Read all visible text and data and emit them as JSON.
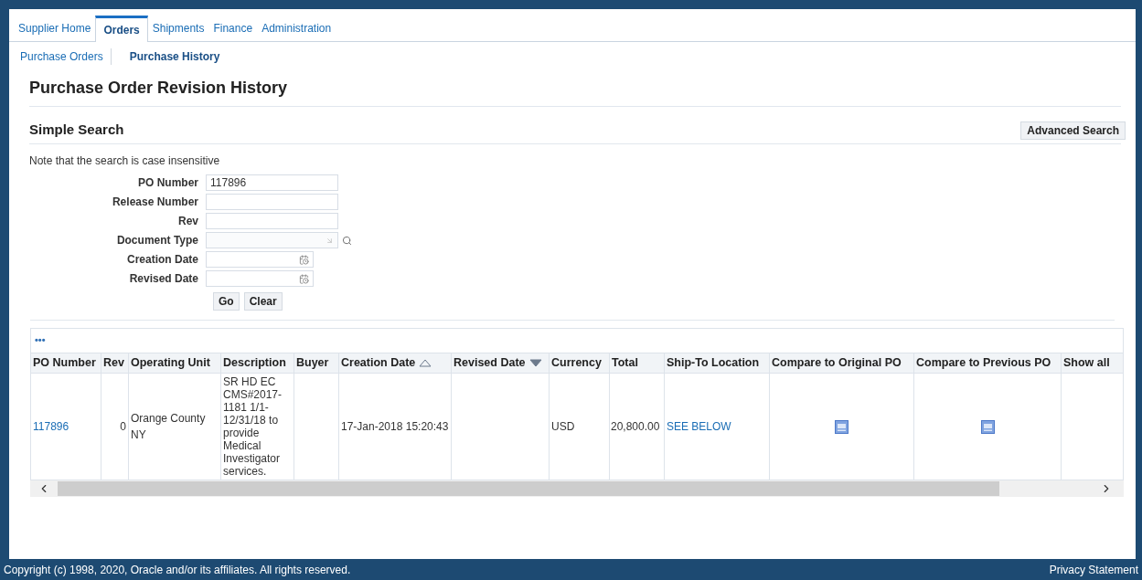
{
  "tabs": [
    {
      "label": "Supplier Home",
      "selected": false
    },
    {
      "label": "Orders",
      "selected": true
    },
    {
      "label": "Shipments",
      "selected": false
    },
    {
      "label": "Finance",
      "selected": false
    },
    {
      "label": "Administration",
      "selected": false
    }
  ],
  "subtabs": [
    {
      "label": "Purchase Orders",
      "selected": false
    },
    {
      "label": "Purchase History",
      "selected": true
    }
  ],
  "page_title": "Purchase Order Revision History",
  "search": {
    "title": "Simple Search",
    "advanced_button": "Advanced Search",
    "note": "Note that the search is case insensitive",
    "fields": [
      {
        "label": "PO Number",
        "kind": "text",
        "value": "117896"
      },
      {
        "label": "Release Number",
        "kind": "text"
      },
      {
        "label": "Rev",
        "kind": "text"
      },
      {
        "label": "Document Type",
        "kind": "lov"
      },
      {
        "label": "Creation Date",
        "kind": "date"
      },
      {
        "label": "Revised Date",
        "kind": "date"
      }
    ],
    "buttons": [
      "Go",
      "Clear"
    ]
  },
  "table": {
    "more": "•••",
    "columns": [
      {
        "label": "PO Number"
      },
      {
        "label": "Rev"
      },
      {
        "label": "Operating Unit"
      },
      {
        "label": "Description"
      },
      {
        "label": "Buyer"
      },
      {
        "label": "Creation Date",
        "kind": "ascending",
        "active": false
      },
      {
        "label": "Revised Date",
        "kind": "descending",
        "active": true
      },
      {
        "label": "Currency"
      },
      {
        "label": "Total"
      },
      {
        "label": "Ship-To Location"
      },
      {
        "label": "Compare to Original PO"
      },
      {
        "label": "Compare to Previous PO"
      },
      {
        "label": "Show all"
      }
    ],
    "rows": [
      {
        "po_number": "117896",
        "rev": "0",
        "operating_unit": "Orange County NY",
        "description": "SR HD EC CMS#2017-1181 1/1-12/31/18 to provide Medical Investigator services.",
        "creation_date": "17-Jan-2018 15:20:43",
        "currency": "USD",
        "total": "20,800.00",
        "ship_to": "SEE BELOW"
      }
    ]
  },
  "footer": {
    "copyright": "Copyright (c) 1998, 2020, Oracle and/or its affiliates. All rights reserved.",
    "privacy": "Privacy Statement"
  }
}
